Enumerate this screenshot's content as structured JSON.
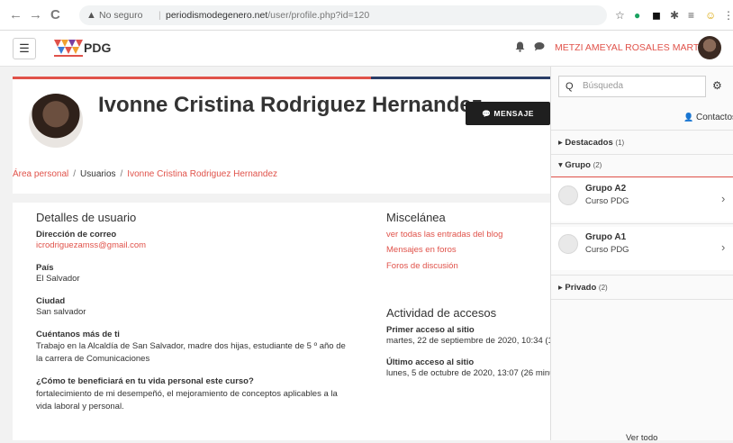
{
  "browser": {
    "back": "←",
    "forward": "→",
    "reload": "C",
    "warning_icon": "▲",
    "security": "No seguro",
    "separator": "|",
    "url_host": "periodismodegenero.net",
    "url_path": "/user/profile.php?id=120",
    "extensions": [
      "☆",
      "●",
      "◼",
      "✱",
      "≡",
      "☺",
      "⋮"
    ]
  },
  "header": {
    "menu_icon": "☰",
    "logo_text": "PDG",
    "bell_icon": "🔔",
    "chat_icon": "💬",
    "user_name": "METZI AMEYAL ROSALES MARTEL"
  },
  "profile": {
    "name": "Ivonne Cristina Rodriguez Hernandez",
    "message_button": "MENSAJE",
    "message_icon": "💬",
    "breadcrumb": {
      "area": "Área personal",
      "users": "Usuarios",
      "current": "Ivonne Cristina Rodriguez Hernandez",
      "sep": "/"
    }
  },
  "details": {
    "title": "Detalles de usuario",
    "email_label": "Dirección de correo",
    "email": "icrodriguezamss@gmail.com",
    "country_label": "País",
    "country": "El Salvador",
    "city_label": "Ciudad",
    "city": "San salvador",
    "about_label": "Cuéntanos más de ti",
    "about": "Trabajo en la Alcaldía de San Salvador, madre dos hijas, estudiante de 5 º año de la carrera de Comunicaciones",
    "benefit_label": "¿Cómo te beneficiará en tu vida personal este curso?",
    "benefit": "fortalecimiento de mi desempeñó, el mejoramiento de conceptos aplicables a la vida laboral y personal."
  },
  "misc": {
    "title": "Miscelánea",
    "links": [
      "ver todas las entradas del blog",
      "Mensajes en foros",
      "Foros de discusión"
    ]
  },
  "access": {
    "title": "Actividad de accesos",
    "first_label": "Primer acceso al sitio",
    "first": "martes, 22 de septiembre de 2020, 10:34 (1",
    "last_label": "Último acceso al sitio",
    "last": "lunes, 5 de octubre de 2020, 13:07 (26 minu"
  },
  "drawer": {
    "search_icon": "Q",
    "search_placeholder": "Búsqueda",
    "gear_icon": "⚙",
    "contacts_label": "Contactos",
    "contacts_icon": "👤",
    "starred_label": "Destacados",
    "starred_count": "(1)",
    "group_label": "Grupo",
    "group_count": "(2)",
    "groups": [
      {
        "name": "Grupo A2",
        "course": "Curso PDG"
      },
      {
        "name": "Grupo A1",
        "course": "Curso PDG"
      }
    ],
    "private_label": "Privado",
    "private_count": "(2)",
    "see_all": "Ver todo",
    "collapsed_icon": "▸",
    "expanded_icon": "▾",
    "chevron_icon": "›"
  }
}
